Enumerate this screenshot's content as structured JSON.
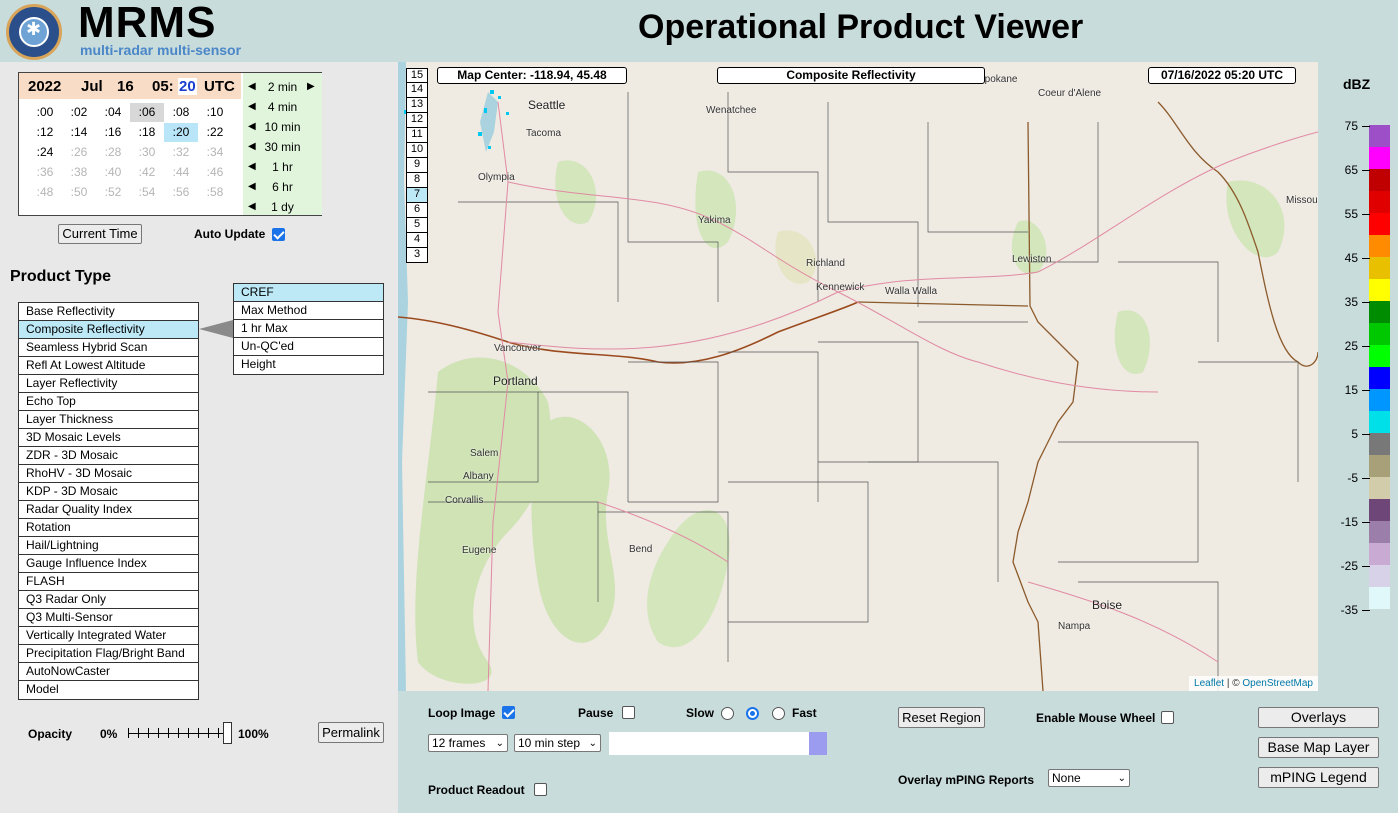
{
  "header": {
    "brand_title": "MRMS",
    "brand_subtitle": "multi-radar multi-sensor",
    "page_title": "Operational Product Viewer"
  },
  "time_selector": {
    "year": "2022",
    "month": "Jul",
    "day": "16",
    "hour": "05:",
    "minute": "20",
    "zone": "UTC",
    "minutes": [
      {
        "label": ":00",
        "state": "normal"
      },
      {
        "label": ":02",
        "state": "normal"
      },
      {
        "label": ":04",
        "state": "normal"
      },
      {
        "label": ":06",
        "state": "gray"
      },
      {
        "label": ":08",
        "state": "normal"
      },
      {
        "label": ":10",
        "state": "normal"
      },
      {
        "label": ":12",
        "state": "normal"
      },
      {
        "label": ":14",
        "state": "normal"
      },
      {
        "label": ":16",
        "state": "normal"
      },
      {
        "label": ":18",
        "state": "normal"
      },
      {
        "label": ":20",
        "state": "selected"
      },
      {
        "label": ":22",
        "state": "normal"
      },
      {
        "label": ":24",
        "state": "normal"
      },
      {
        "label": ":26",
        "state": "dim"
      },
      {
        "label": ":28",
        "state": "dim"
      },
      {
        "label": ":30",
        "state": "dim"
      },
      {
        "label": ":32",
        "state": "dim"
      },
      {
        "label": ":34",
        "state": "dim"
      },
      {
        "label": ":36",
        "state": "dim"
      },
      {
        "label": ":38",
        "state": "dim"
      },
      {
        "label": ":40",
        "state": "dim"
      },
      {
        "label": ":42",
        "state": "dim"
      },
      {
        "label": ":44",
        "state": "dim"
      },
      {
        "label": ":46",
        "state": "dim"
      },
      {
        "label": ":48",
        "state": "dim"
      },
      {
        "label": ":50",
        "state": "dim"
      },
      {
        "label": ":52",
        "state": "dim"
      },
      {
        "label": ":54",
        "state": "dim"
      },
      {
        "label": ":56",
        "state": "dim"
      },
      {
        "label": ":58",
        "state": "dim"
      }
    ],
    "steps": [
      "2 min",
      "4 min",
      "10 min",
      "30 min",
      "1 hr",
      "6 hr",
      "1 dy"
    ],
    "current_time_label": "Current Time",
    "auto_update_label": "Auto Update",
    "auto_update_checked": true
  },
  "product_type": {
    "heading": "Product Type",
    "items": [
      "Base Reflectivity",
      "Composite Reflectivity",
      "Seamless Hybrid Scan",
      "Refl At Lowest Altitude",
      "Layer Reflectivity",
      "Echo Top",
      "Layer Thickness",
      "3D Mosaic Levels",
      "ZDR - 3D Mosaic",
      "RhoHV - 3D Mosaic",
      "KDP - 3D Mosaic",
      "Radar Quality Index",
      "Rotation",
      "Hail/Lightning",
      "Gauge Influence Index",
      "FLASH",
      "Q3 Radar Only",
      "Q3 Multi-Sensor",
      "Vertically Integrated Water",
      "Precipitation Flag/Bright Band",
      "AutoNowCaster",
      "Model"
    ],
    "selected": "Composite Reflectivity",
    "sub_items": [
      "CREF",
      "Max Method",
      "1 hr Max",
      "Un-QC'ed",
      "Height"
    ],
    "sub_selected": "CREF"
  },
  "opacity": {
    "label": "Opacity",
    "min_label": "0%",
    "max_label": "100%",
    "value_fraction": 1.0,
    "permalink_label": "Permalink"
  },
  "map": {
    "center_text": "Map Center: -118.94, 45.48",
    "product_text": "Composite Reflectivity",
    "datetime_text": "07/16/2022   05:20 UTC",
    "frames": [
      "15",
      "14",
      "13",
      "12",
      "11",
      "10",
      "9",
      "8",
      "7",
      "6",
      "5",
      "4",
      "3"
    ],
    "selected_frame": "7",
    "cities": [
      "Seattle",
      "Tacoma",
      "Olympia",
      "Wenatchee",
      "Yakima",
      "Richland",
      "Kennewick",
      "Walla Walla",
      "Lewiston",
      "Vancouver",
      "Portland",
      "Salem",
      "Albany",
      "Corvallis",
      "Eugene",
      "Bend",
      "Boise",
      "Nampa",
      "Coeur d'Alene",
      "Spokane",
      "Missoula"
    ],
    "attribution_leaflet": "Leaflet",
    "attribution_sep": " | © ",
    "attribution_osm": "OpenStreetMap"
  },
  "legend": {
    "unit": "dBZ",
    "ticks": [
      "75",
      "65",
      "55",
      "45",
      "35",
      "25",
      "15",
      "5",
      "-5",
      "-15",
      "-25",
      "-35"
    ],
    "colors": [
      "#9c4fc7",
      "#ff00ff",
      "#c00000",
      "#e00000",
      "#ff0000",
      "#ff8c00",
      "#e8c000",
      "#ffff00",
      "#008c00",
      "#00c800",
      "#00ff00",
      "#0000ff",
      "#0096ff",
      "#00e0e8",
      "#787878",
      "#a8a078",
      "#d2ccaa",
      "#6e4678",
      "#9c7eaa",
      "#c8aad2",
      "#d8d2e8",
      "#e0f8fa"
    ]
  },
  "controls": {
    "loop_image_label": "Loop Image",
    "loop_image_checked": true,
    "pause_label": "Pause",
    "slow_label": "Slow",
    "fast_label": "Fast",
    "speed_selected_index": 1,
    "frames_select": "12 frames",
    "step_select": "10 min step",
    "product_readout_label": "Product Readout",
    "reset_region_label": "Reset Region",
    "mouse_wheel_label": "Enable Mouse Wheel",
    "overlay_mping_label": "Overlay mPING Reports",
    "mping_select": "None",
    "overlays_label": "Overlays",
    "base_map_label": "Base Map Layer",
    "mping_legend_label": "mPING Legend"
  }
}
